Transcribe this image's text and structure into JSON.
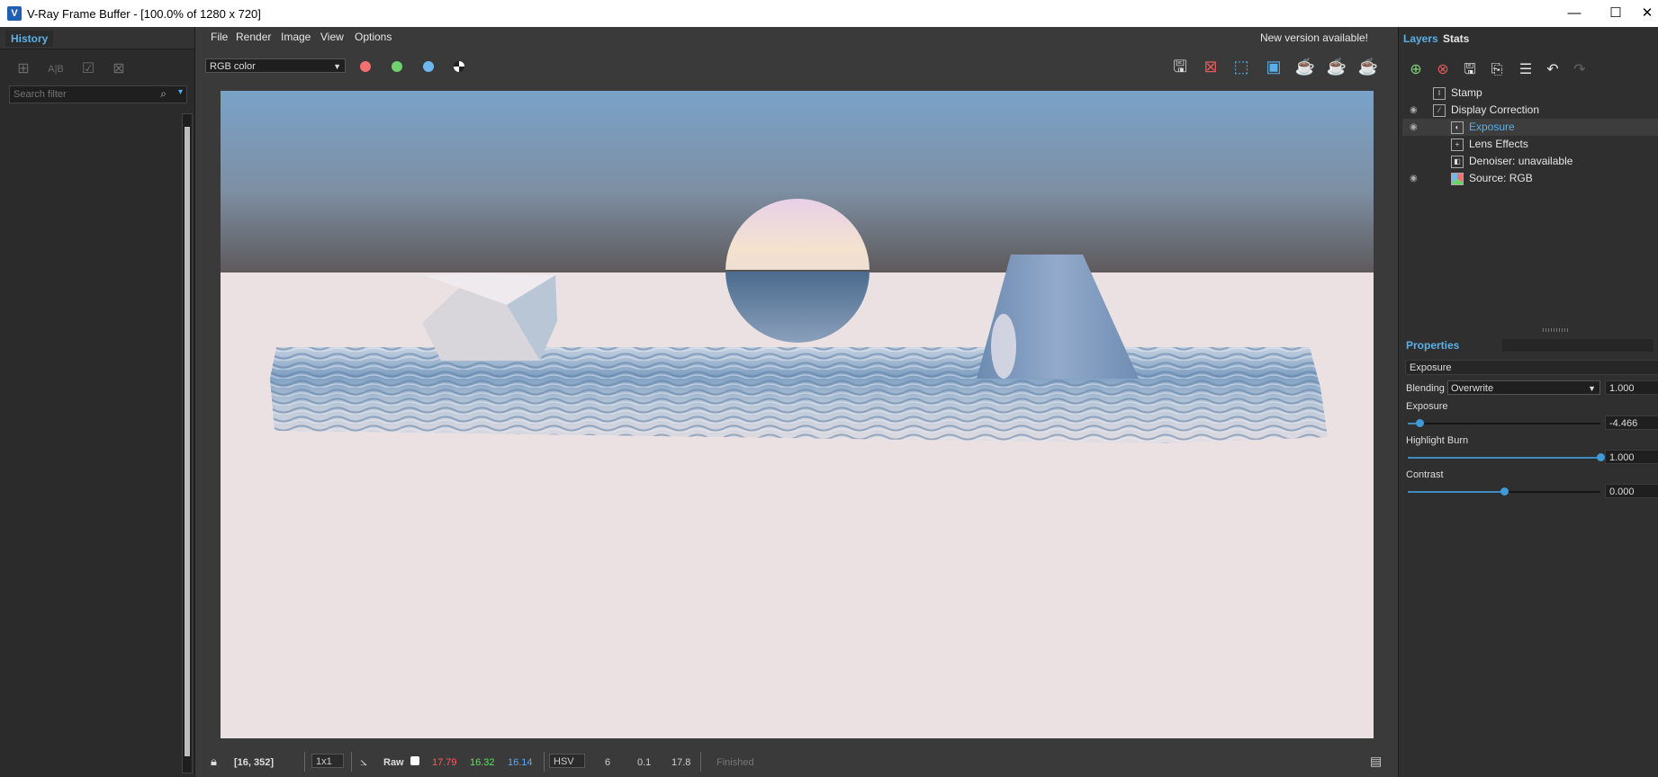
{
  "window": {
    "title": "V-Ray Frame Buffer - [100.0% of 1280 x 720]",
    "app_icon_letter": "V",
    "minimize_glyph": "—",
    "maximize_glyph": "☐",
    "close_glyph": "✕"
  },
  "history": {
    "tab_label": "History",
    "tools": [
      "add-icon",
      "compare-ab-icon",
      "load-icon",
      "clear-icon"
    ],
    "search_placeholder": "Search filter"
  },
  "menu": {
    "items": [
      "File",
      "Render",
      "Image",
      "View",
      "Options"
    ],
    "notice": "New version available!"
  },
  "toolbar": {
    "channel": "RGB color",
    "channel_dots": [
      {
        "name": "red-channel",
        "color": "#f27070"
      },
      {
        "name": "green-channel",
        "color": "#6fd26f"
      },
      {
        "name": "blue-channel",
        "color": "#6fb8ef"
      }
    ],
    "right_tools": [
      "save-image-icon",
      "clear-image-icon",
      "region-render-icon",
      "render-region-frame-icon",
      "interactive-render-icon",
      "stop-render-icon",
      "render-icon"
    ]
  },
  "status": {
    "coords": "[16, 352]",
    "ratio": "1x1",
    "mode": "Raw",
    "r": "17.79",
    "g": "16.32",
    "b": "16.14",
    "color_space": "HSV",
    "h": "6",
    "s": "0.1",
    "v": "17.8",
    "state": "Finished"
  },
  "layers": {
    "tabs": [
      "Layers",
      "Stats"
    ],
    "items": [
      {
        "name": "Stamp",
        "visible": false,
        "indent": 1,
        "selected": false,
        "icon": "stamp-icon"
      },
      {
        "name": "Display Correction",
        "visible": true,
        "indent": 1,
        "selected": false,
        "icon": "curve-icon"
      },
      {
        "name": "Exposure",
        "visible": true,
        "indent": 2,
        "selected": true,
        "icon": "exposure-icon"
      },
      {
        "name": "Lens Effects",
        "visible": false,
        "indent": 2,
        "selected": false,
        "icon": "lens-effects-icon"
      },
      {
        "name": "Denoiser: unavailable",
        "visible": false,
        "indent": 2,
        "selected": false,
        "icon": "denoiser-icon"
      },
      {
        "name": "Source: RGB",
        "visible": true,
        "indent": 2,
        "selected": false,
        "icon": "source-rgb-icon"
      }
    ]
  },
  "properties": {
    "header": "Properties",
    "layer_name": "Exposure",
    "blending_label": "Blending",
    "blending_value": "Overwrite",
    "blending_amount": "1.000",
    "exposure_label": "Exposure",
    "exposure_value": "-4.466",
    "exposure_level": 0.06,
    "highlight_label": "Highlight Burn",
    "highlight_value": "1.000",
    "highlight_level": 1.0,
    "contrast_label": "Contrast",
    "contrast_value": "0.000",
    "contrast_level": 0.5
  },
  "colors": {
    "accent": "#5ab0e6",
    "status_r": "#ff5b5b",
    "status_g": "#5fe05f",
    "status_b": "#5aa9f0"
  }
}
